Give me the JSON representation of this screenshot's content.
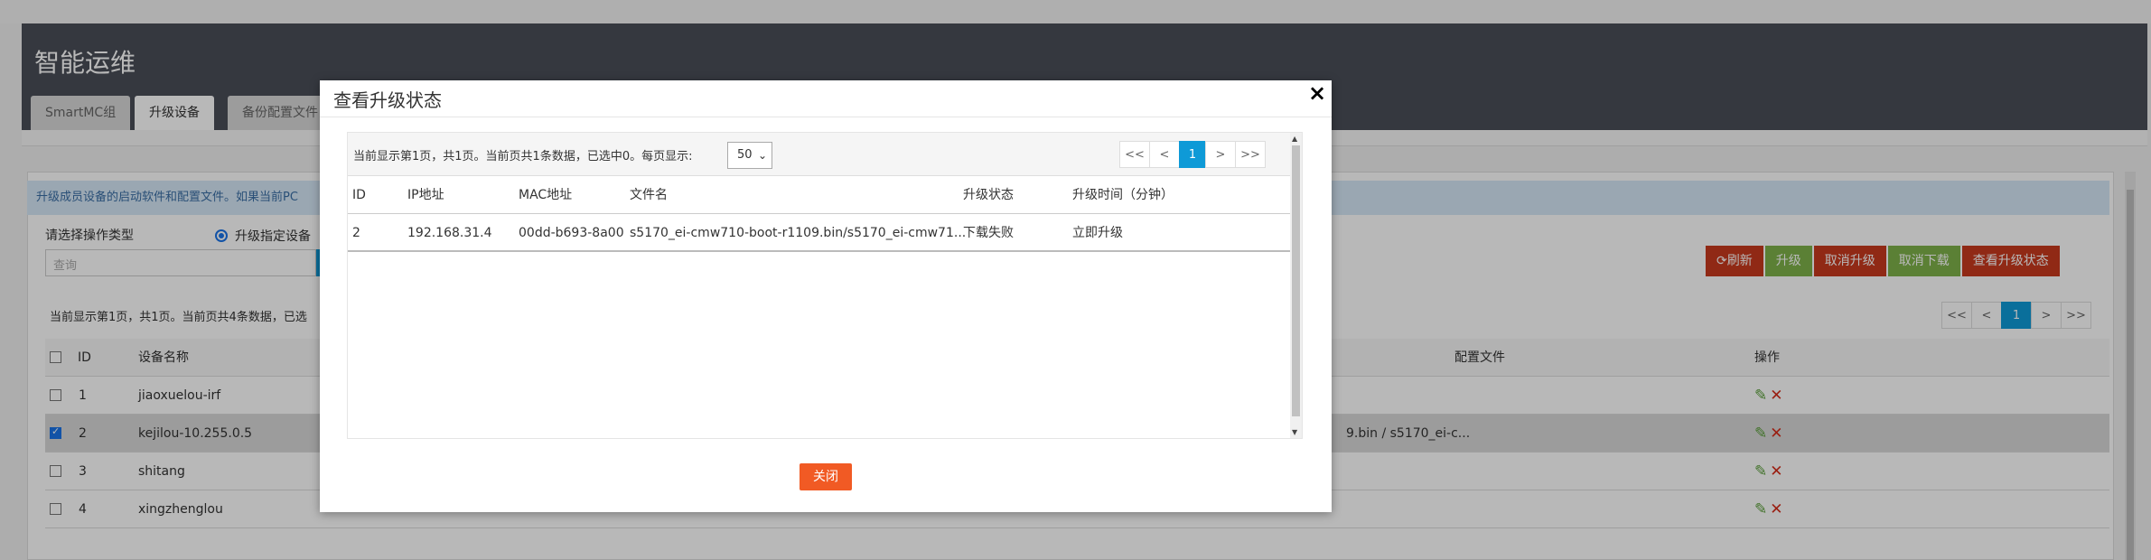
{
  "app": {
    "title": "智能运维"
  },
  "tabs": [
    {
      "label": "SmartMC组"
    },
    {
      "label": "升级设备"
    },
    {
      "label": "备份配置文件"
    }
  ],
  "notice": "升级成员设备的启动软件和配置文件。如果当前PC",
  "op_type": {
    "label": "请选择操作类型",
    "radio_label": "升级指定设备"
  },
  "search": {
    "placeholder": "查询"
  },
  "buttons": {
    "refresh": "刷新",
    "upgrade": "升级",
    "cancel_upgrade": "取消升级",
    "cancel_download": "取消下载",
    "view_status": "查看升级状态"
  },
  "list_info": "当前显示第1页，共1页。当前页共4条数据，已选",
  "pager": {
    "first": "<<",
    "prev": "<",
    "current": "1",
    "next": ">",
    "last": ">>"
  },
  "table": {
    "headers": {
      "id": "ID",
      "name": "设备名称",
      "config": "配置文件",
      "ops": "操作"
    },
    "rows": [
      {
        "id": "1",
        "name": "jiaoxuelou-irf",
        "config": "",
        "selected": false
      },
      {
        "id": "2",
        "name": "kejilou-10.255.0.5",
        "config": "9.bin / s5170_ei-c...",
        "selected": true
      },
      {
        "id": "3",
        "name": "shitang",
        "config": "",
        "selected": false
      },
      {
        "id": "4",
        "name": "xingzhenglou",
        "config": "",
        "selected": false
      }
    ]
  },
  "modal": {
    "title": "查看升级状态",
    "close_x": "×",
    "info": "当前显示第1页，共1页。当前页共1条数据，已选中0。每页显示:",
    "page_size": "50",
    "headers": {
      "id": "ID",
      "ip": "IP地址",
      "mac": "MAC地址",
      "file": "文件名",
      "status": "升级状态",
      "time": "升级时间（分钟）"
    },
    "rows": [
      {
        "id": "2",
        "ip": "192.168.31.4",
        "mac": "00dd-b693-8a00",
        "file": "s5170_ei-cmw710-boot-r1109.bin/s5170_ei-cmw71...",
        "status": "下载失败",
        "time": "立即升级"
      }
    ],
    "close_button": "关闭"
  },
  "colors": {
    "header_bg": "#4a4e58",
    "accent": "#0e9ad7",
    "danger": "#c83a1e",
    "success": "#7fb24a",
    "close_btn": "#f15a24"
  }
}
